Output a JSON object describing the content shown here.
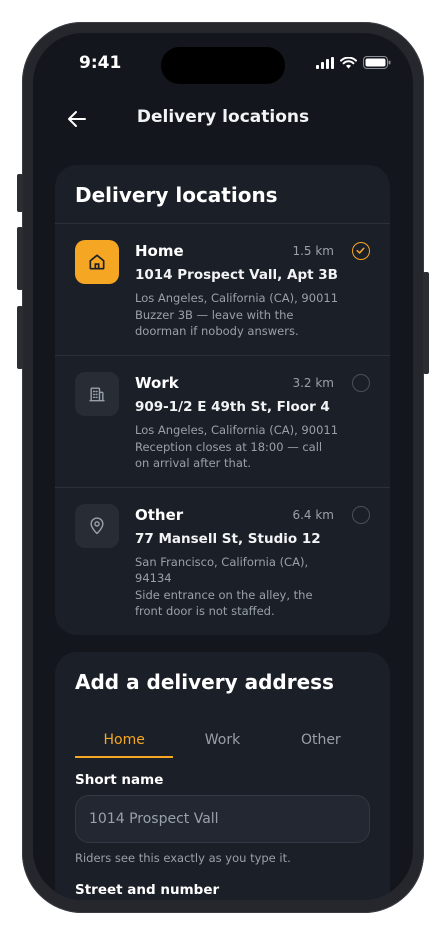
{
  "status": {
    "time": "9:41"
  },
  "nav": {
    "title": "Delivery locations"
  },
  "locations_card": {
    "title": "Delivery locations",
    "items": [
      {
        "name": "Home",
        "distance": "1.5 km",
        "address": "1014 Prospect Vall, Apt 3B",
        "city": "Los Angeles, California (CA), 90011",
        "note": "Buzzer 3B — leave with the doorman if nobody answers.",
        "icon": "home-icon",
        "selected": true
      },
      {
        "name": "Work",
        "distance": "3.2 km",
        "address": "909-1/2 E 49th St, Floor 4",
        "city": "Los Angeles, California (CA), 90011",
        "note": "Reception closes at 18:00 — call on arrival after that.",
        "icon": "building-icon",
        "selected": false
      },
      {
        "name": "Other",
        "distance": "6.4 km",
        "address": "77 Mansell St, Studio 12",
        "city": "San Francisco, California (CA), 94134",
        "note": "Side entrance on the alley, the front door is not staffed.",
        "icon": "map-pin-icon",
        "selected": false
      }
    ]
  },
  "add_card": {
    "title": "Add a delivery address",
    "tabs": [
      "Home",
      "Work",
      "Other"
    ],
    "active_tab": "Home",
    "short_name_label": "Short name",
    "short_name_placeholder": "1014 Prospect Vall",
    "short_name_hint": "Riders see this exactly as you type it.",
    "street_label": "Street and number"
  },
  "colors": {
    "accent": "#f5a623",
    "background": "#13161c",
    "card": "#1b1f27"
  }
}
